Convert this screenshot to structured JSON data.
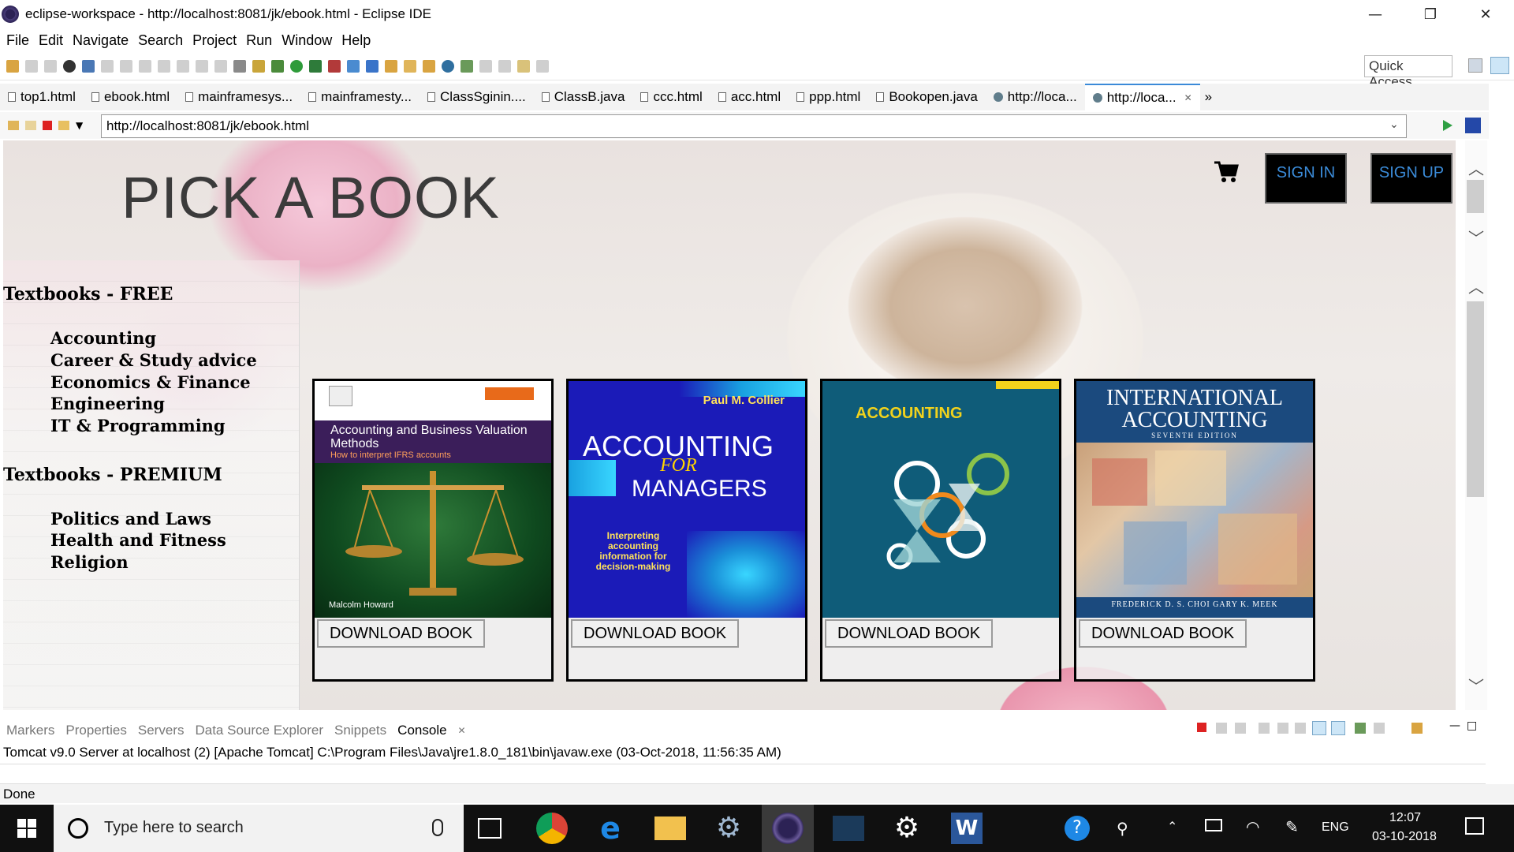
{
  "window": {
    "title": "eclipse-workspace - http://localhost:8081/jk/ebook.html - Eclipse IDE",
    "minimize": "—",
    "maximize": "❐",
    "close": "✕"
  },
  "menu": [
    "File",
    "Edit",
    "Navigate",
    "Search",
    "Project",
    "Run",
    "Window",
    "Help"
  ],
  "quick_access": "Quick Access",
  "tabs": [
    {
      "label": "top1.html",
      "icon": "html-file-icon"
    },
    {
      "label": "ebook.html",
      "icon": "html-file-icon"
    },
    {
      "label": "mainframesys...",
      "icon": "html-file-icon"
    },
    {
      "label": "mainframesty...",
      "icon": "html-file-icon"
    },
    {
      "label": "ClassSginin....",
      "icon": "java-file-icon"
    },
    {
      "label": "ClassB.java",
      "icon": "java-file-icon"
    },
    {
      "label": "ccc.html",
      "icon": "html-file-icon"
    },
    {
      "label": "acc.html",
      "icon": "html-file-icon"
    },
    {
      "label": "ppp.html",
      "icon": "html-file-icon"
    },
    {
      "label": "Bookopen.java",
      "icon": "java-file-icon"
    },
    {
      "label": "http://loca...",
      "icon": "globe-icon"
    },
    {
      "label": "http://loca...",
      "icon": "globe-icon",
      "active": true
    }
  ],
  "tab_overflow": "»",
  "address": "http://localhost:8081/jk/ebook.html",
  "page": {
    "title": "PICK A BOOK",
    "sign_in": "SIGN IN",
    "sign_up": "SIGN UP",
    "sidebar": {
      "free_heading": "Textbooks - FREE",
      "free_items": [
        "Accounting",
        "Career & Study advice",
        "Economics & Finance",
        "Engineering",
        "IT & Programming"
      ],
      "premium_heading": "Textbooks - PREMIUM",
      "premium_items": [
        "Politics and Laws",
        "Health and Fitness",
        "Religion"
      ]
    },
    "books": [
      {
        "title": "Accounting and Business Valuation Methods",
        "subtitle": "How to interpret IFRS accounts",
        "author": "Malcolm Howard",
        "button": "DOWNLOAD BOOK"
      },
      {
        "author": "Paul M. Collier",
        "title1": "ACCOUNTING",
        "title2": "FOR",
        "title3": "MANAGERS",
        "subtitle": "Interpreting accounting information for decision-making",
        "button": "DOWNLOAD BOOK"
      },
      {
        "title": "ACCOUNTING",
        "button": "DOWNLOAD BOOK"
      },
      {
        "title": "INTERNATIONAL ACCOUNTING",
        "edition": "SEVENTH EDITION",
        "authors": "FREDERICK D. S. CHOI     GARY K. MEEK",
        "button": "DOWNLOAD BOOK"
      }
    ]
  },
  "bottom_tabs": [
    "Markers",
    "Properties",
    "Servers",
    "Data Source Explorer",
    "Snippets",
    "Console"
  ],
  "console_line": "Tomcat v9.0 Server at localhost (2) [Apache Tomcat] C:\\Program Files\\Java\\jre1.8.0_181\\bin\\javaw.exe (03-Oct-2018, 11:56:35 AM)",
  "status": "Done",
  "taskbar": {
    "search_placeholder": "Type here to search",
    "language": "ENG",
    "time": "12:07",
    "date": "03-10-2018"
  },
  "colors": {
    "accent_blue": "#3b8bd8",
    "button_black": "#000000"
  }
}
